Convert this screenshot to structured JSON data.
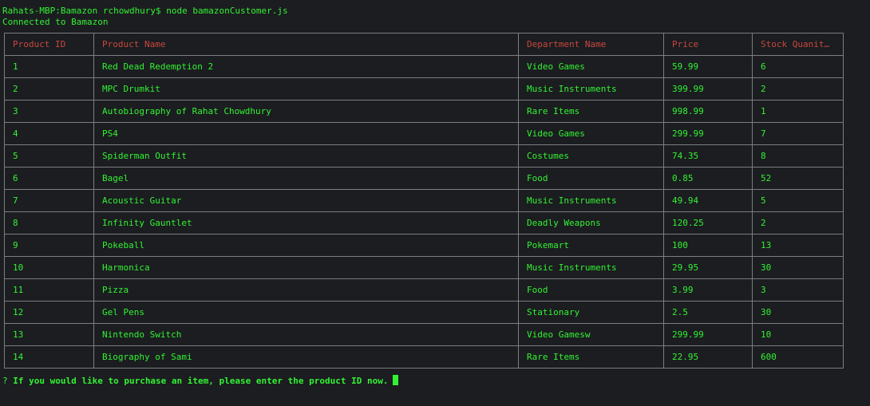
{
  "terminal": {
    "command_line": "Rahats-MBP:Bamazon rchowdhury$ node bamazonCustomer.js",
    "status_line": "Connected to Bamazon",
    "prompt_symbol": "?",
    "prompt_text": "If you would like to purchase an item, please enter the product ID now."
  },
  "table": {
    "headers": [
      "Product ID",
      "Product Name",
      "Department Name",
      "Price",
      "Stock Quanit…"
    ],
    "rows": [
      [
        "1",
        "Red Dead Redemption 2",
        "Video Games",
        "59.99",
        "6"
      ],
      [
        "2",
        "MPC Drumkit",
        "Music Instruments",
        "399.99",
        "2"
      ],
      [
        "3",
        "Autobiography of Rahat Chowdhury",
        "Rare Items",
        "998.99",
        "1"
      ],
      [
        "4",
        "PS4",
        "Video Games",
        "299.99",
        "7"
      ],
      [
        "5",
        "Spiderman Outfit",
        "Costumes",
        "74.35",
        "8"
      ],
      [
        "6",
        "Bagel",
        "Food",
        "0.85",
        "52"
      ],
      [
        "7",
        "Acoustic Guitar",
        "Music Instruments",
        "49.94",
        "5"
      ],
      [
        "8",
        "Infinity Gauntlet",
        "Deadly Weapons",
        "120.25",
        "2"
      ],
      [
        "9",
        "Pokeball",
        "Pokemart",
        "100",
        "13"
      ],
      [
        "10",
        "Harmonica",
        "Music Instruments",
        "29.95",
        "30"
      ],
      [
        "11",
        "Pizza",
        "Food",
        "3.99",
        "3"
      ],
      [
        "12",
        "Gel Pens",
        "Stationary",
        "2.5",
        "30"
      ],
      [
        "13",
        "Nintendo Switch",
        "Video Gamesw",
        "299.99",
        "10"
      ],
      [
        "14",
        "Biography of Sami",
        "Rare Items",
        "22.95",
        "600"
      ]
    ]
  },
  "colors": {
    "background": "#1b1d20",
    "text_green": "#33f233",
    "header_red": "#c8473f",
    "border_gray": "#7a7f80"
  }
}
